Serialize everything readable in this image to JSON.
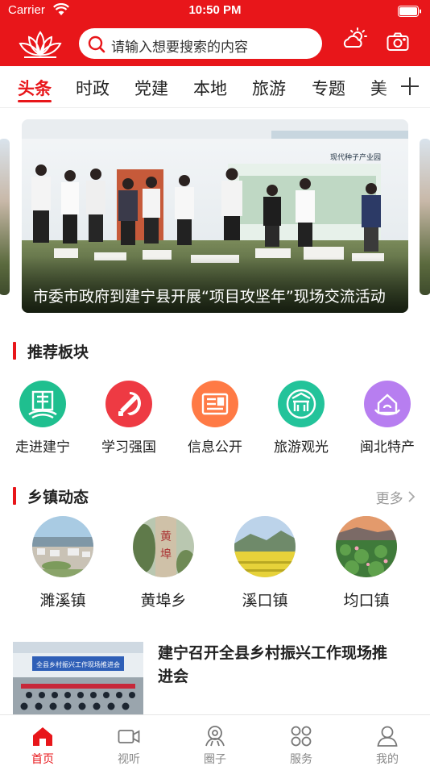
{
  "status": {
    "carrier": "Carrier",
    "time": "10:50 PM"
  },
  "search": {
    "placeholder": "请输入想要搜索的内容"
  },
  "tabs": [
    {
      "label": "头条",
      "active": true
    },
    {
      "label": "时政",
      "active": false
    },
    {
      "label": "党建",
      "active": false
    },
    {
      "label": "本地",
      "active": false
    },
    {
      "label": "旅游",
      "active": false
    },
    {
      "label": "专题",
      "active": false
    },
    {
      "label": "美",
      "active": false
    }
  ],
  "banner": {
    "caption": "市委市政府到建宁县开展“项目攻坚年”现场交流活动",
    "sign_text": "现代种子产业园"
  },
  "sections": {
    "recommended": {
      "title": "推荐板块"
    },
    "towns": {
      "title": "乡镇动态",
      "more": "更多"
    }
  },
  "categories": [
    {
      "label": "走进建宁",
      "color": "#1fbf8f",
      "icon": "building-icon"
    },
    {
      "label": "学习强国",
      "color": "#ee3a43",
      "icon": "party-emblem-icon"
    },
    {
      "label": "信息公开",
      "color": "#ff7a45",
      "icon": "document-icon"
    },
    {
      "label": "旅游观光",
      "color": "#23c39a",
      "icon": "scenic-gate-icon"
    },
    {
      "label": "闽北特产",
      "color": "#b77ef0",
      "icon": "specialty-icon"
    }
  ],
  "towns": [
    {
      "label": "濉溪镇"
    },
    {
      "label": "黄埠乡"
    },
    {
      "label": "溪口镇"
    },
    {
      "label": "均口镇"
    }
  ],
  "news": [
    {
      "title": "建宁召开全县乡村振兴工作现场推进会",
      "image_caption": "全县乡村振兴工作现场推进会"
    }
  ],
  "bottom_nav": [
    {
      "label": "首页",
      "active": true
    },
    {
      "label": "视听",
      "active": false
    },
    {
      "label": "圈子",
      "active": false
    },
    {
      "label": "服务",
      "active": false
    },
    {
      "label": "我的",
      "active": false
    }
  ],
  "colors": {
    "brand_red": "#e8161a",
    "text": "#222222",
    "muted": "#888888"
  }
}
